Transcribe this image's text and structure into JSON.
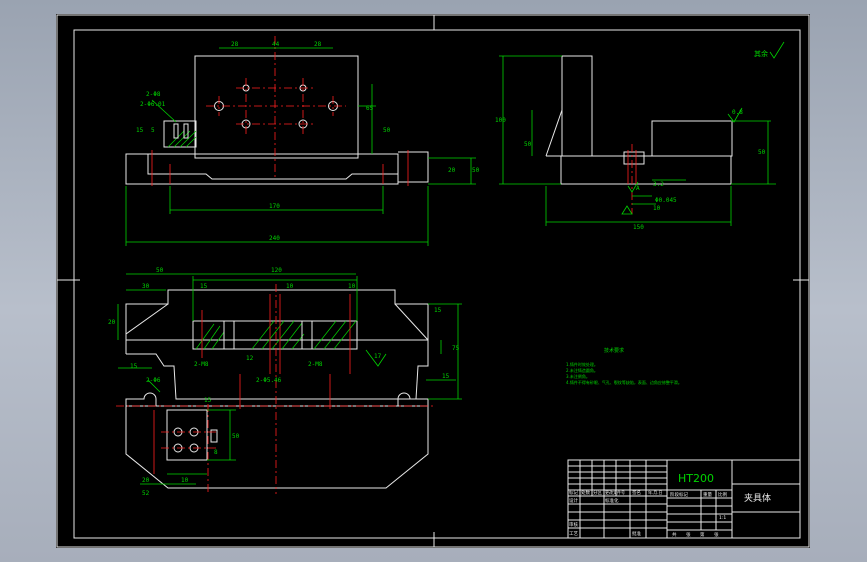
{
  "drawing": {
    "roughness_symbol": "其余",
    "material": "HT200",
    "part_name": "夹具体",
    "title_block": {
      "row_a": [
        "标记",
        "处数",
        "分区",
        "更改文件号",
        "签名",
        "年.月.日"
      ],
      "row_b": [
        "设计",
        "",
        "",
        "标准化"
      ],
      "row_c": [
        "审核",
        "",
        "",
        ""
      ],
      "row_d": [
        "工艺",
        "",
        "",
        "批准"
      ],
      "stage_headers": [
        "阶段标记",
        "重量",
        "比例"
      ],
      "scale": "1:1",
      "sheet": [
        "共",
        "张",
        "第",
        "张"
      ]
    },
    "tech_req": {
      "title": "技术要求",
      "lines": [
        "1.铸件时效处理。",
        "2.未注铸造圆角。",
        "3.未注倒角。",
        "4.铸件不得有砂眼、气孔、裂纹等缺陷，表面、边角应修整平滑。"
      ]
    },
    "dims": {
      "front": [
        "28",
        "44",
        "28",
        "2-Φ8",
        "2-Φ6.01",
        "15",
        "5",
        "65",
        "50",
        "20",
        "170",
        "240",
        "50"
      ],
      "side": [
        "100",
        "50",
        "0.8",
        "50",
        "3.2",
        "Φ0.045",
        "10",
        "150",
        "A"
      ],
      "top": [
        "50",
        "120",
        "30",
        "15",
        "10",
        "10",
        "20",
        "15",
        "75",
        "17",
        "2-M8",
        "2-M8",
        "2-Φ5.46",
        "12",
        "15",
        "2-Φ6",
        "15",
        "15",
        "50",
        "8",
        "20",
        "10",
        "52"
      ]
    }
  }
}
